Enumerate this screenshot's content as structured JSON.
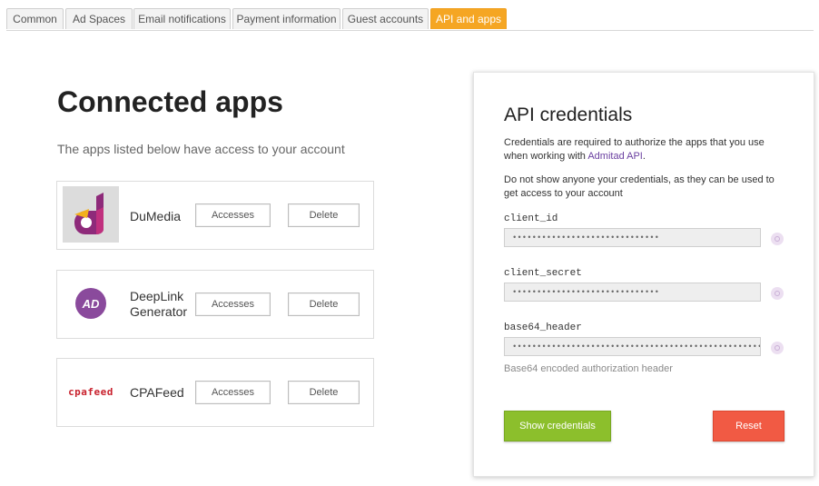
{
  "tabs": [
    {
      "label": "Common",
      "active": false
    },
    {
      "label": "Ad Spaces",
      "active": false
    },
    {
      "label": "Email notifications",
      "active": false
    },
    {
      "label": "Payment information",
      "active": false
    },
    {
      "label": "Guest accounts",
      "active": false
    },
    {
      "label": "API and apps",
      "active": true
    }
  ],
  "connected": {
    "title": "Connected apps",
    "subtitle": "The apps listed below have access to your account",
    "apps": [
      {
        "name": "DuMedia",
        "logo_icon": "dumedia-logo",
        "accesses_label": "Accesses",
        "delete_label": "Delete"
      },
      {
        "name": "DeepLink Generator",
        "logo_icon": "deeplink-generator-logo",
        "logo_text": "AD",
        "accesses_label": "Accesses",
        "delete_label": "Delete"
      },
      {
        "name": "CPAFeed",
        "logo_icon": "cpafeed-logo",
        "logo_text": "cpafeed",
        "accesses_label": "Accesses",
        "delete_label": "Delete"
      }
    ]
  },
  "api": {
    "title": "API credentials",
    "text1_before": "Credentials are required to authorize the apps that you use when working with ",
    "text1_link": "Admitad API",
    "text1_after": ".",
    "text2": "Do not show anyone your credentials, as they can be used to get access to your account",
    "fields": [
      {
        "label": "client_id",
        "value": "••••••••••••••••••••••••••••••"
      },
      {
        "label": "client_secret",
        "value": "••••••••••••••••••••••••••••••"
      },
      {
        "label": "base64_header",
        "value": "••••••••••••••••••••••••••••••••••••••••••••••••••••••••••••••••••••••••",
        "hint": "Base64 encoded authorization header"
      }
    ],
    "show_button": "Show credentials",
    "reset_button": "Reset"
  },
  "colors": {
    "tab_active": "#f5a623",
    "brand_purple": "#8a4a9c",
    "show_button": "#8cbf2c",
    "reset_button": "#f15a44",
    "link": "#6a3fa0"
  }
}
